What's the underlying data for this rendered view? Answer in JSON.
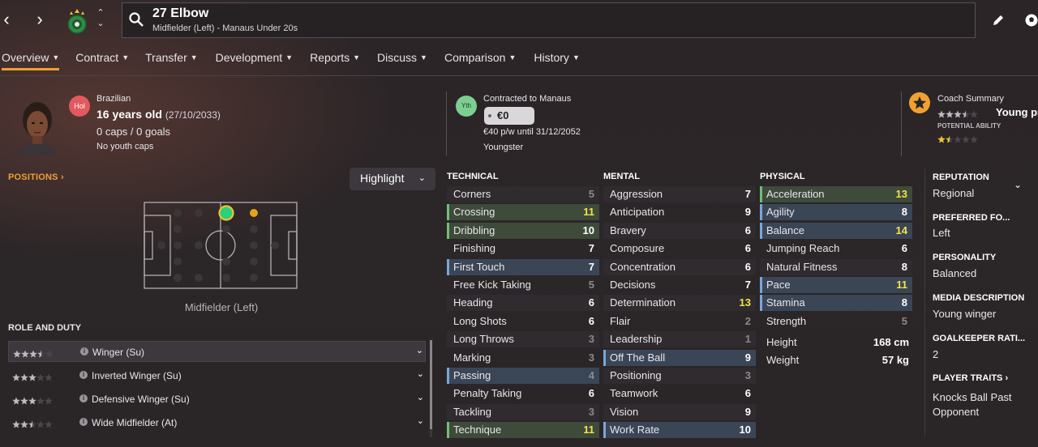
{
  "header": {
    "player_title": "27 Elbow",
    "player_subtitle": "Midfielder (Left) - Manaus Under 20s"
  },
  "tabs": [
    {
      "label": "Overview",
      "active": true
    },
    {
      "label": "Contract"
    },
    {
      "label": "Transfer"
    },
    {
      "label": "Development"
    },
    {
      "label": "Reports"
    },
    {
      "label": "Discuss"
    },
    {
      "label": "Comparison"
    },
    {
      "label": "History"
    }
  ],
  "profile": {
    "position_badge": "Hol",
    "nationality": "Brazilian",
    "age": "16 years old",
    "dob": "(27/10/2033)",
    "caps": "0 caps / 0 goals",
    "youth_caps": "No youth caps"
  },
  "contract": {
    "badge": "Yth",
    "contracted_to": "Contracted to Manaus",
    "value": "€0",
    "wage": "€40 p/w until 31/12/2052",
    "status": "Youngster"
  },
  "coach": {
    "title": "Coach Summary",
    "summary": "Young pr",
    "current_ability_stars": 3.5,
    "potential_label": "POTENTIAL ABILITY",
    "potential_ability_stars": 1.5
  },
  "positions": {
    "title": "POSITIONS",
    "highlight_label": "Highlight",
    "pitch_label": "Midfielder (Left)"
  },
  "roles": {
    "title": "ROLE AND DUTY",
    "items": [
      {
        "label": "Winger (Su)",
        "stars": 3.5
      },
      {
        "label": "Inverted Winger (Su)",
        "stars": 3
      },
      {
        "label": "Defensive Winger (Su)",
        "stars": 3
      },
      {
        "label": "Wide Midfielder (At)",
        "stars": 2.5
      }
    ]
  },
  "technical": {
    "title": "TECHNICAL",
    "attrs": [
      {
        "name": "Corners",
        "value": "5",
        "hl": ""
      },
      {
        "name": "Crossing",
        "value": "11",
        "hl": "green"
      },
      {
        "name": "Dribbling",
        "value": "10",
        "hl": "green"
      },
      {
        "name": "Finishing",
        "value": "7",
        "hl": ""
      },
      {
        "name": "First Touch",
        "value": "7",
        "hl": "blue"
      },
      {
        "name": "Free Kick Taking",
        "value": "5",
        "hl": ""
      },
      {
        "name": "Heading",
        "value": "6",
        "hl": ""
      },
      {
        "name": "Long Shots",
        "value": "6",
        "hl": ""
      },
      {
        "name": "Long Throws",
        "value": "3",
        "hl": ""
      },
      {
        "name": "Marking",
        "value": "3",
        "hl": ""
      },
      {
        "name": "Passing",
        "value": "4",
        "hl": "blue"
      },
      {
        "name": "Penalty Taking",
        "value": "6",
        "hl": ""
      },
      {
        "name": "Tackling",
        "value": "3",
        "hl": ""
      },
      {
        "name": "Technique",
        "value": "11",
        "hl": "green"
      }
    ]
  },
  "mental": {
    "title": "MENTAL",
    "attrs": [
      {
        "name": "Aggression",
        "value": "7",
        "hl": ""
      },
      {
        "name": "Anticipation",
        "value": "9",
        "hl": ""
      },
      {
        "name": "Bravery",
        "value": "6",
        "hl": ""
      },
      {
        "name": "Composure",
        "value": "6",
        "hl": ""
      },
      {
        "name": "Concentration",
        "value": "6",
        "hl": ""
      },
      {
        "name": "Decisions",
        "value": "7",
        "hl": ""
      },
      {
        "name": "Determination",
        "value": "13",
        "hl": ""
      },
      {
        "name": "Flair",
        "value": "2",
        "hl": ""
      },
      {
        "name": "Leadership",
        "value": "1",
        "hl": ""
      },
      {
        "name": "Off The Ball",
        "value": "9",
        "hl": "blue"
      },
      {
        "name": "Positioning",
        "value": "3",
        "hl": ""
      },
      {
        "name": "Teamwork",
        "value": "6",
        "hl": ""
      },
      {
        "name": "Vision",
        "value": "9",
        "hl": ""
      },
      {
        "name": "Work Rate",
        "value": "10",
        "hl": "blue"
      }
    ]
  },
  "physical": {
    "title": "PHYSICAL",
    "attrs": [
      {
        "name": "Acceleration",
        "value": "13",
        "hl": "green"
      },
      {
        "name": "Agility",
        "value": "8",
        "hl": "blue"
      },
      {
        "name": "Balance",
        "value": "14",
        "hl": "blue"
      },
      {
        "name": "Jumping Reach",
        "value": "6",
        "hl": ""
      },
      {
        "name": "Natural Fitness",
        "value": "8",
        "hl": ""
      },
      {
        "name": "Pace",
        "value": "11",
        "hl": "blue"
      },
      {
        "name": "Stamina",
        "value": "8",
        "hl": "blue"
      },
      {
        "name": "Strength",
        "value": "5",
        "hl": ""
      }
    ],
    "height_label": "Height",
    "height": "168 cm",
    "weight_label": "Weight",
    "weight": "57 kg"
  },
  "side": {
    "reputation_label": "REPUTATION",
    "reputation": "Regional",
    "foot_label": "PREFERRED FO...",
    "foot": "Left",
    "personality_label": "PERSONALITY",
    "personality": "Balanced",
    "media_label": "MEDIA DESCRIPTION",
    "media": "Young winger",
    "gk_label": "GOALKEEPER RATI...",
    "gk": "2",
    "traits_label": "PLAYER TRAITS",
    "trait_line1": "Knocks Ball Past",
    "trait_line2": "Opponent"
  },
  "colors": {
    "accent": "#f0a032",
    "highlight_green": "#3e4a3a",
    "highlight_blue": "#3a4656",
    "value_yellow": "#f3e34a"
  }
}
